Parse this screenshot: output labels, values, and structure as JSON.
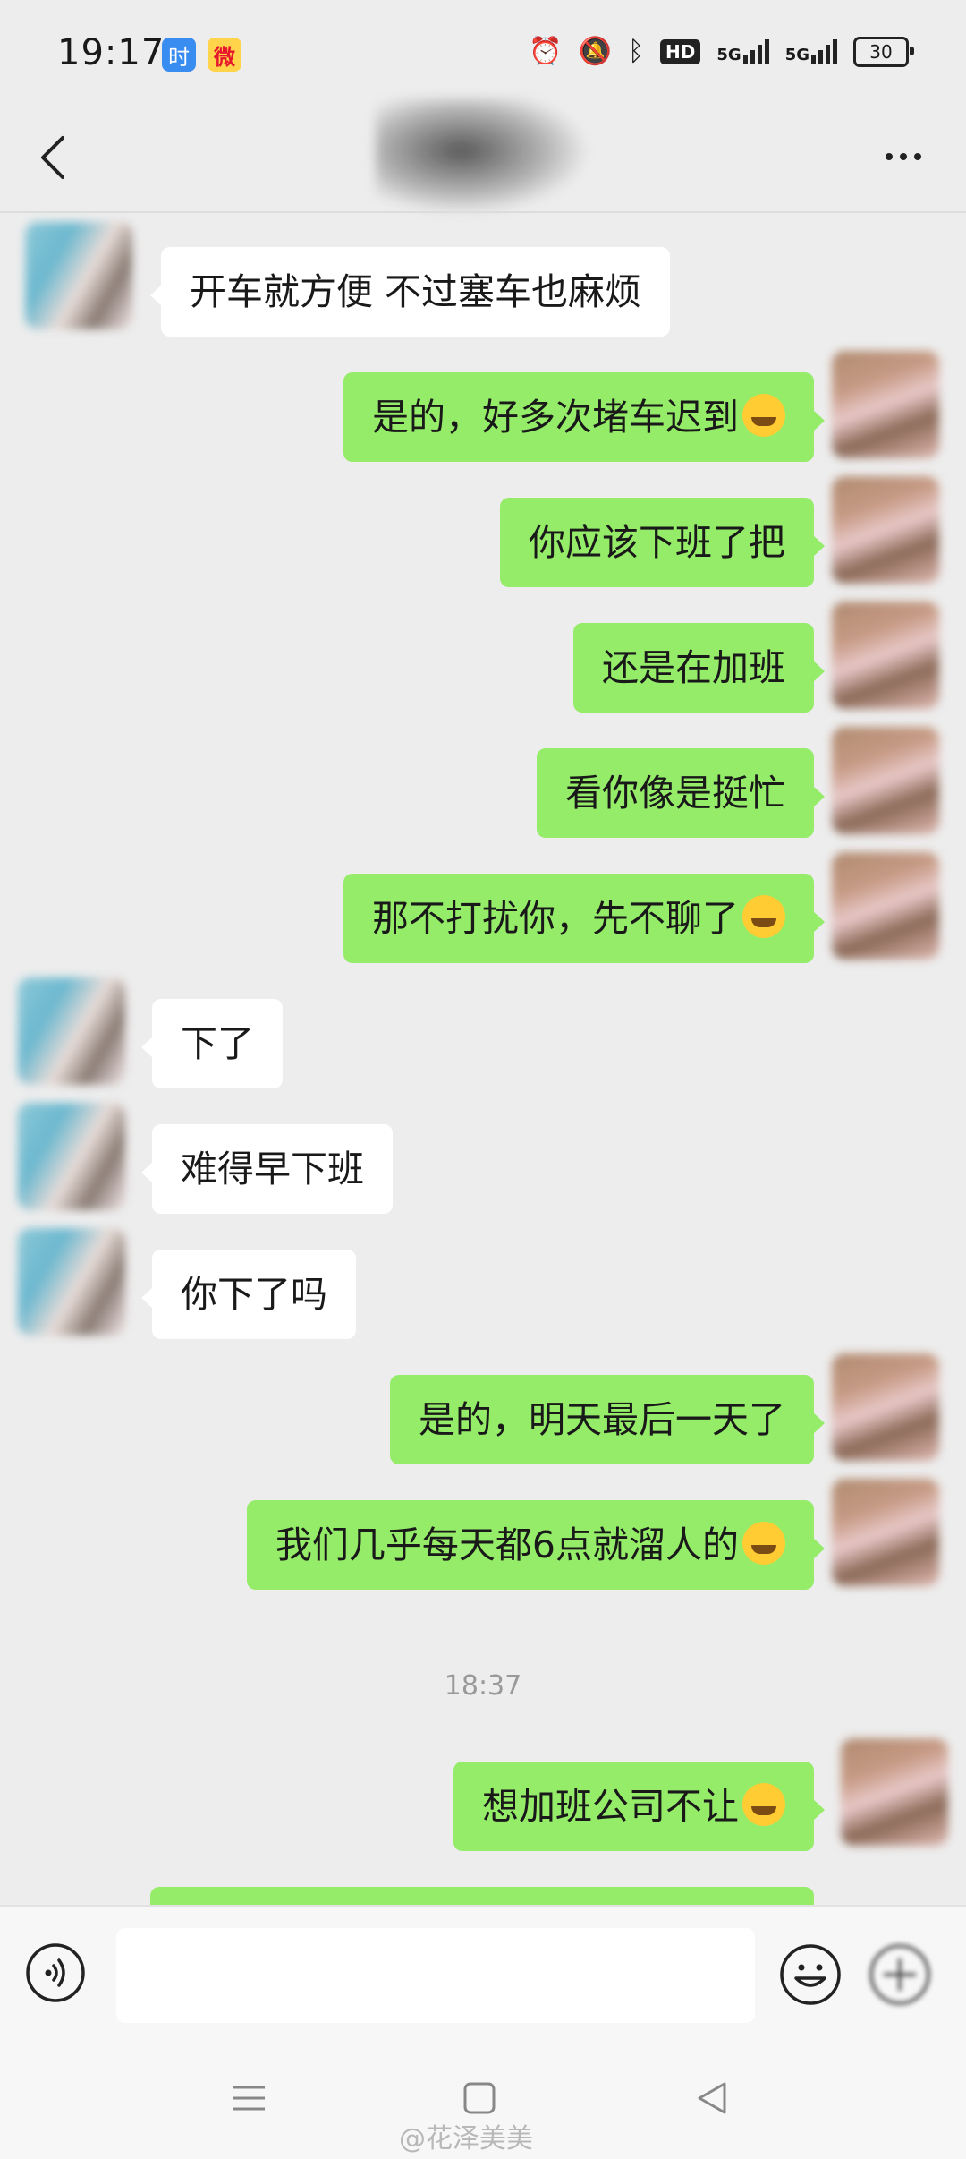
{
  "status_bar": {
    "time": "19:17",
    "app_badge_1": "时",
    "app_badge_2": "微",
    "hd_label": "HD",
    "signal_1_label": "5G",
    "signal_2_label": "5G",
    "battery": "30"
  },
  "header": {
    "back_icon": "chevron-left-icon",
    "more_icon": "more-dots-icon"
  },
  "messages": [
    {
      "side": "in",
      "text": "开车就方便 不过塞车也麻烦"
    },
    {
      "side": "out",
      "text": "是的，好多次堵车迟到",
      "emoji": "laugh-cry"
    },
    {
      "side": "out",
      "text": "你应该下班了把"
    },
    {
      "side": "out",
      "text": "还是在加班"
    },
    {
      "side": "out",
      "text": "看你像是挺忙"
    },
    {
      "side": "out",
      "text": "那不打扰你，先不聊了",
      "emoji": "grin"
    },
    {
      "side": "in",
      "text": "下了"
    },
    {
      "side": "in",
      "text": "难得早下班"
    },
    {
      "side": "in",
      "text": "你下了吗"
    },
    {
      "side": "out",
      "text": "是的，明天最后一天了"
    },
    {
      "side": "out",
      "text": "我们几乎每天都6点就溜人的",
      "emoji": "laugh-cry"
    },
    {
      "side": "out",
      "text": "想加班公司不让",
      "emoji": "thinking"
    }
  ],
  "timestamp": "18:37",
  "input_bar": {
    "voice_icon": "voice-icon",
    "emoji_icon": "emoji-face-icon",
    "placeholder": ""
  },
  "nav_bar": {
    "watermark": "@花泽美美"
  },
  "colors": {
    "background": "#ededed",
    "outgoing_bubble": "#95ec69",
    "incoming_bubble": "#ffffff"
  }
}
